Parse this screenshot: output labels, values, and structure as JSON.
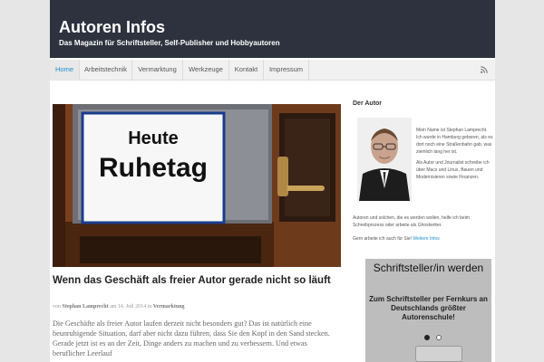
{
  "site": {
    "title": "Autoren Infos",
    "description": "Das Magazin für Schriftsteller, Self-Publisher und Hobbyautoren"
  },
  "nav": {
    "items": [
      "Home",
      "Arbeitstechnik",
      "Vermarktung",
      "Werkzeuge",
      "Kontakt",
      "Impressum"
    ],
    "active": "Home"
  },
  "post": {
    "image_sign_line1": "Heute",
    "image_sign_line2": "Ruhetag",
    "title": "Wenn das Geschäft als freier Autor gerade nicht so läuft",
    "meta_by": "von",
    "author": "Stephan Lamprecht",
    "meta_on": "am",
    "date": "14. Juli 2014",
    "meta_in": "in",
    "category": "Vermarktung",
    "excerpt": "Die Geschäfte als freier Autor laufen derzeit nicht besonders gut? Das ist natürlich eine beunruhigende Situation, darf aber nicht dazu führen, dass Sie den Kopf in den Sand stecken. Gerade jetzt ist es an der Zeit, Dinge anders zu machen und zu verbessern. Und etwas beruflicher Leerlauf"
  },
  "sidebar": {
    "heading": "Der Autor",
    "bio_p1": "Mein Name ist Stephan Lamprecht. Ich wurde in Hamburg geboren, als es dort noch eine Straßenbahn gab, was ziemlich lang her ist.",
    "bio_p2": "Als Autor und Journalist schreibe ich über Macs und Linux, Bauen und Modernisieren sowie Finanzen.",
    "bio_p3": "Autoren und solchen, die es werden wollen, helfe ich beim Schreibprozess oder arbeite als Ghostwriter.",
    "bio_p4": "Gern arbeite ich auch für Sie!",
    "more_link": "Weitere Infos"
  },
  "ad": {
    "title": "Schriftsteller/in werden",
    "text": "Zum Schriftsteller per Fernkurs an Deutschlands größter Autorenschule!"
  },
  "colors": {
    "header_bg": "#2e323e",
    "accent": "#1e8ecf",
    "rss": "#e07a1f"
  }
}
